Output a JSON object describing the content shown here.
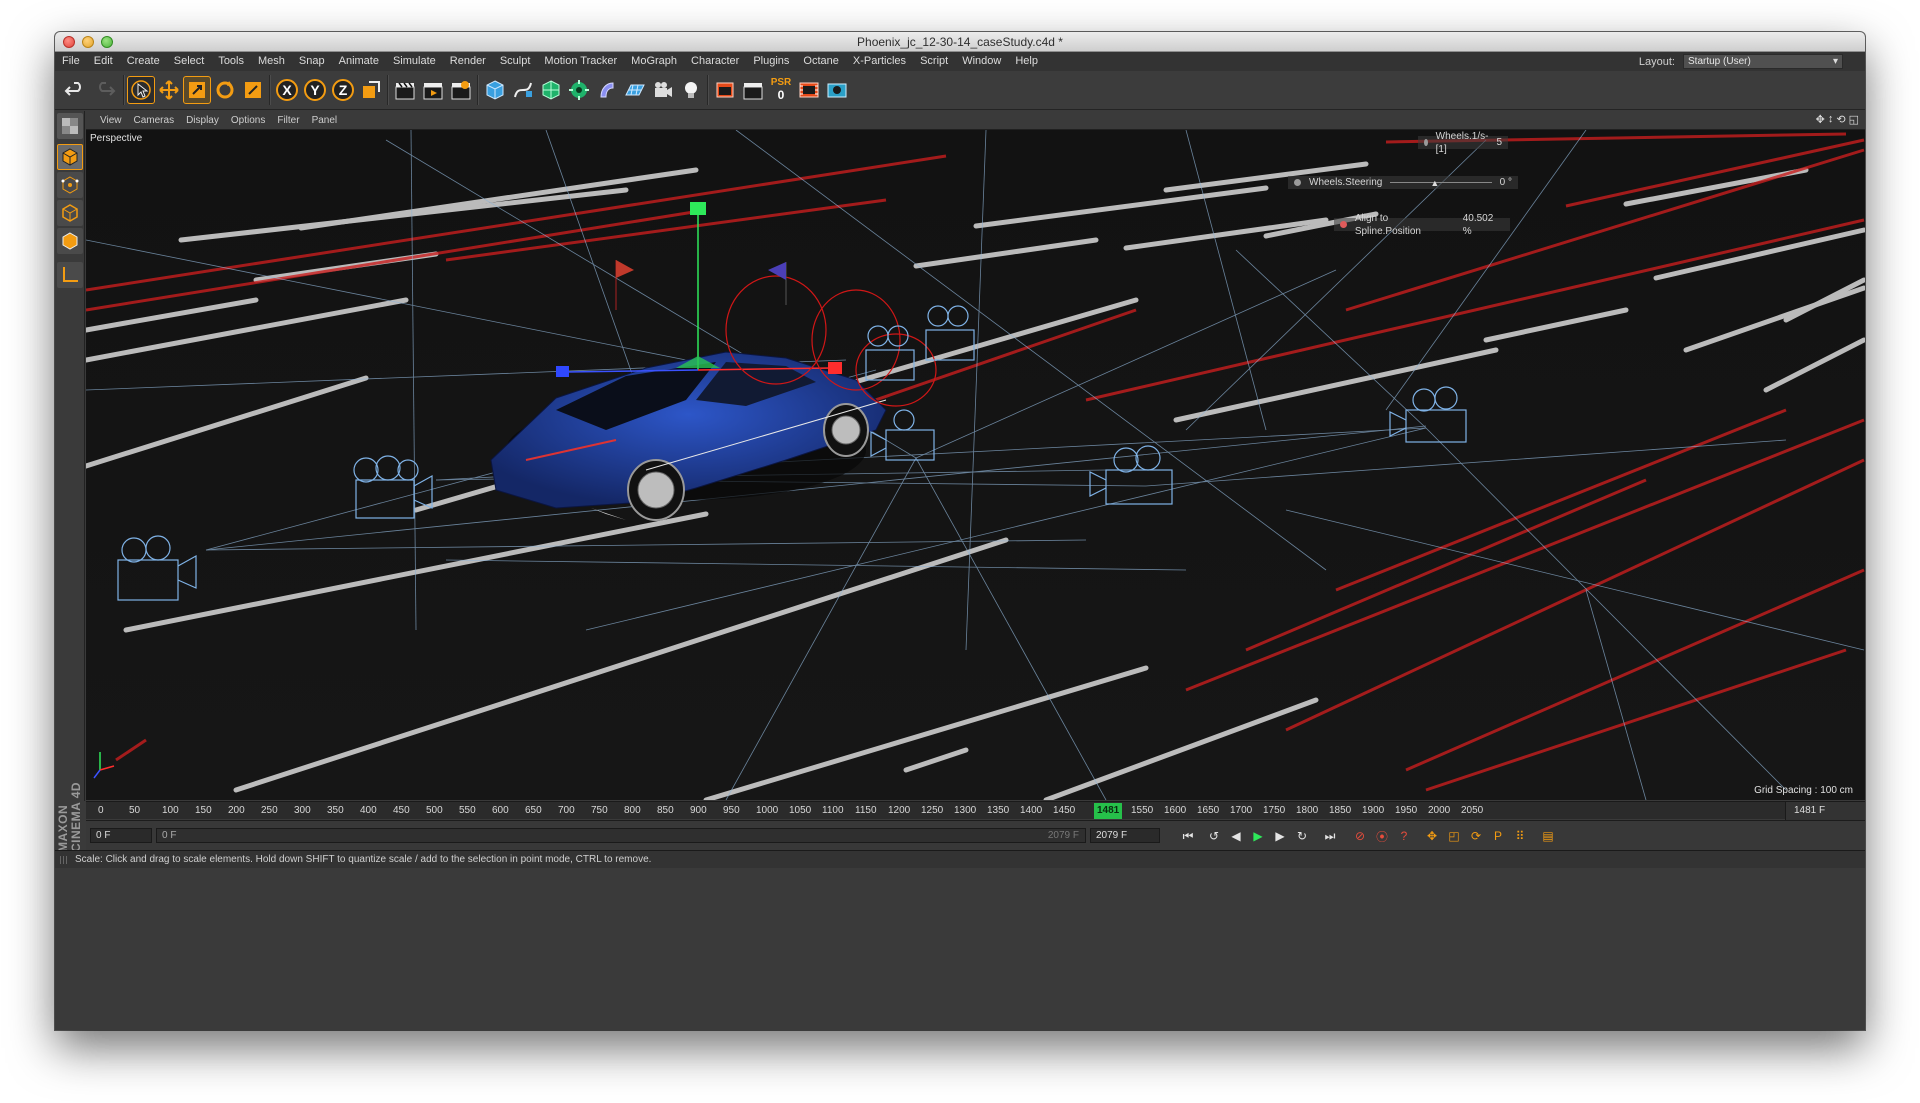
{
  "window": {
    "title": "Phoenix_jc_12-30-14_caseStudy.c4d *"
  },
  "menubar": {
    "items": [
      "File",
      "Edit",
      "Create",
      "Select",
      "Tools",
      "Mesh",
      "Snap",
      "Animate",
      "Simulate",
      "Render",
      "Sculpt",
      "Motion Tracker",
      "MoGraph",
      "Character",
      "Plugins",
      "Octane",
      "X-Particles",
      "Script",
      "Window",
      "Help"
    ],
    "layout_label": "Layout:",
    "layout_value": "Startup (User)"
  },
  "toolbar": {
    "psr_label": "PSR",
    "psr_value": "0",
    "axis_x": "X",
    "axis_y": "Y",
    "axis_z": "Z"
  },
  "viewport_menu": {
    "items": [
      "View",
      "Cameras",
      "Display",
      "Options",
      "Filter",
      "Panel"
    ]
  },
  "viewport": {
    "camera_label": "Perspective",
    "hud": {
      "wheels_rate_label": "Wheels.1/s-[1]",
      "wheels_rate_value": "5",
      "steering_label": "Wheels.Steering",
      "steering_value": "0 °",
      "align_label": "Align to Spline.Position",
      "align_value": "40.502 %"
    },
    "grid_spacing": "Grid Spacing : 100 cm"
  },
  "timeline": {
    "ticks": [
      "0",
      "50",
      "100",
      "150",
      "200",
      "250",
      "300",
      "350",
      "400",
      "450",
      "500",
      "550",
      "600",
      "650",
      "700",
      "750",
      "800",
      "850",
      "900",
      "950",
      "1000",
      "1050",
      "1100",
      "1150",
      "1200",
      "1250",
      "1300",
      "1350",
      "1400",
      "1450",
      "1481",
      "1550",
      "1600",
      "1650",
      "1700",
      "1750",
      "1800",
      "1850",
      "1900",
      "1950",
      "2000",
      "2050"
    ],
    "current_frame_label": "1481",
    "current_frame_display": "1481 F",
    "start_field": "0 F",
    "min_field": "0 F",
    "range_end": "2079 F",
    "end_field": "2079 F"
  },
  "branding": {
    "text": "MAXON CINEMA 4D"
  },
  "status": {
    "text": "Scale: Click and drag to scale elements. Hold down SHIFT to quantize scale / add to the selection in point mode, CTRL to remove."
  },
  "colors": {
    "accent_orange": "#f39c12",
    "viewport_bg": "#0b0b0b",
    "playhead_green": "#26c04a",
    "car_blue": "#1f3a8f",
    "trail_red": "#c81e1e"
  }
}
